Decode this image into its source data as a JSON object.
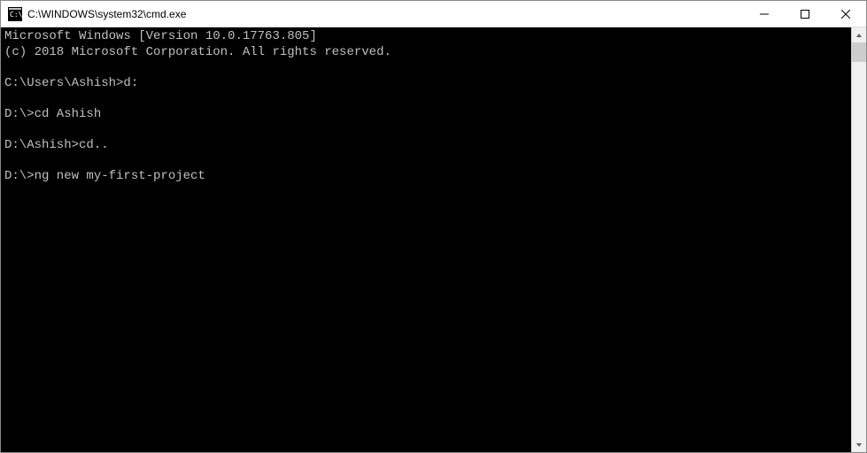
{
  "titlebar": {
    "title": "C:\\WINDOWS\\system32\\cmd.exe"
  },
  "terminal": {
    "lines": [
      "Microsoft Windows [Version 10.0.17763.805]",
      "(c) 2018 Microsoft Corporation. All rights reserved.",
      "",
      "C:\\Users\\Ashish>d:",
      "",
      "D:\\>cd Ashish",
      "",
      "D:\\Ashish>cd..",
      "",
      "D:\\>ng new my-first-project"
    ]
  }
}
